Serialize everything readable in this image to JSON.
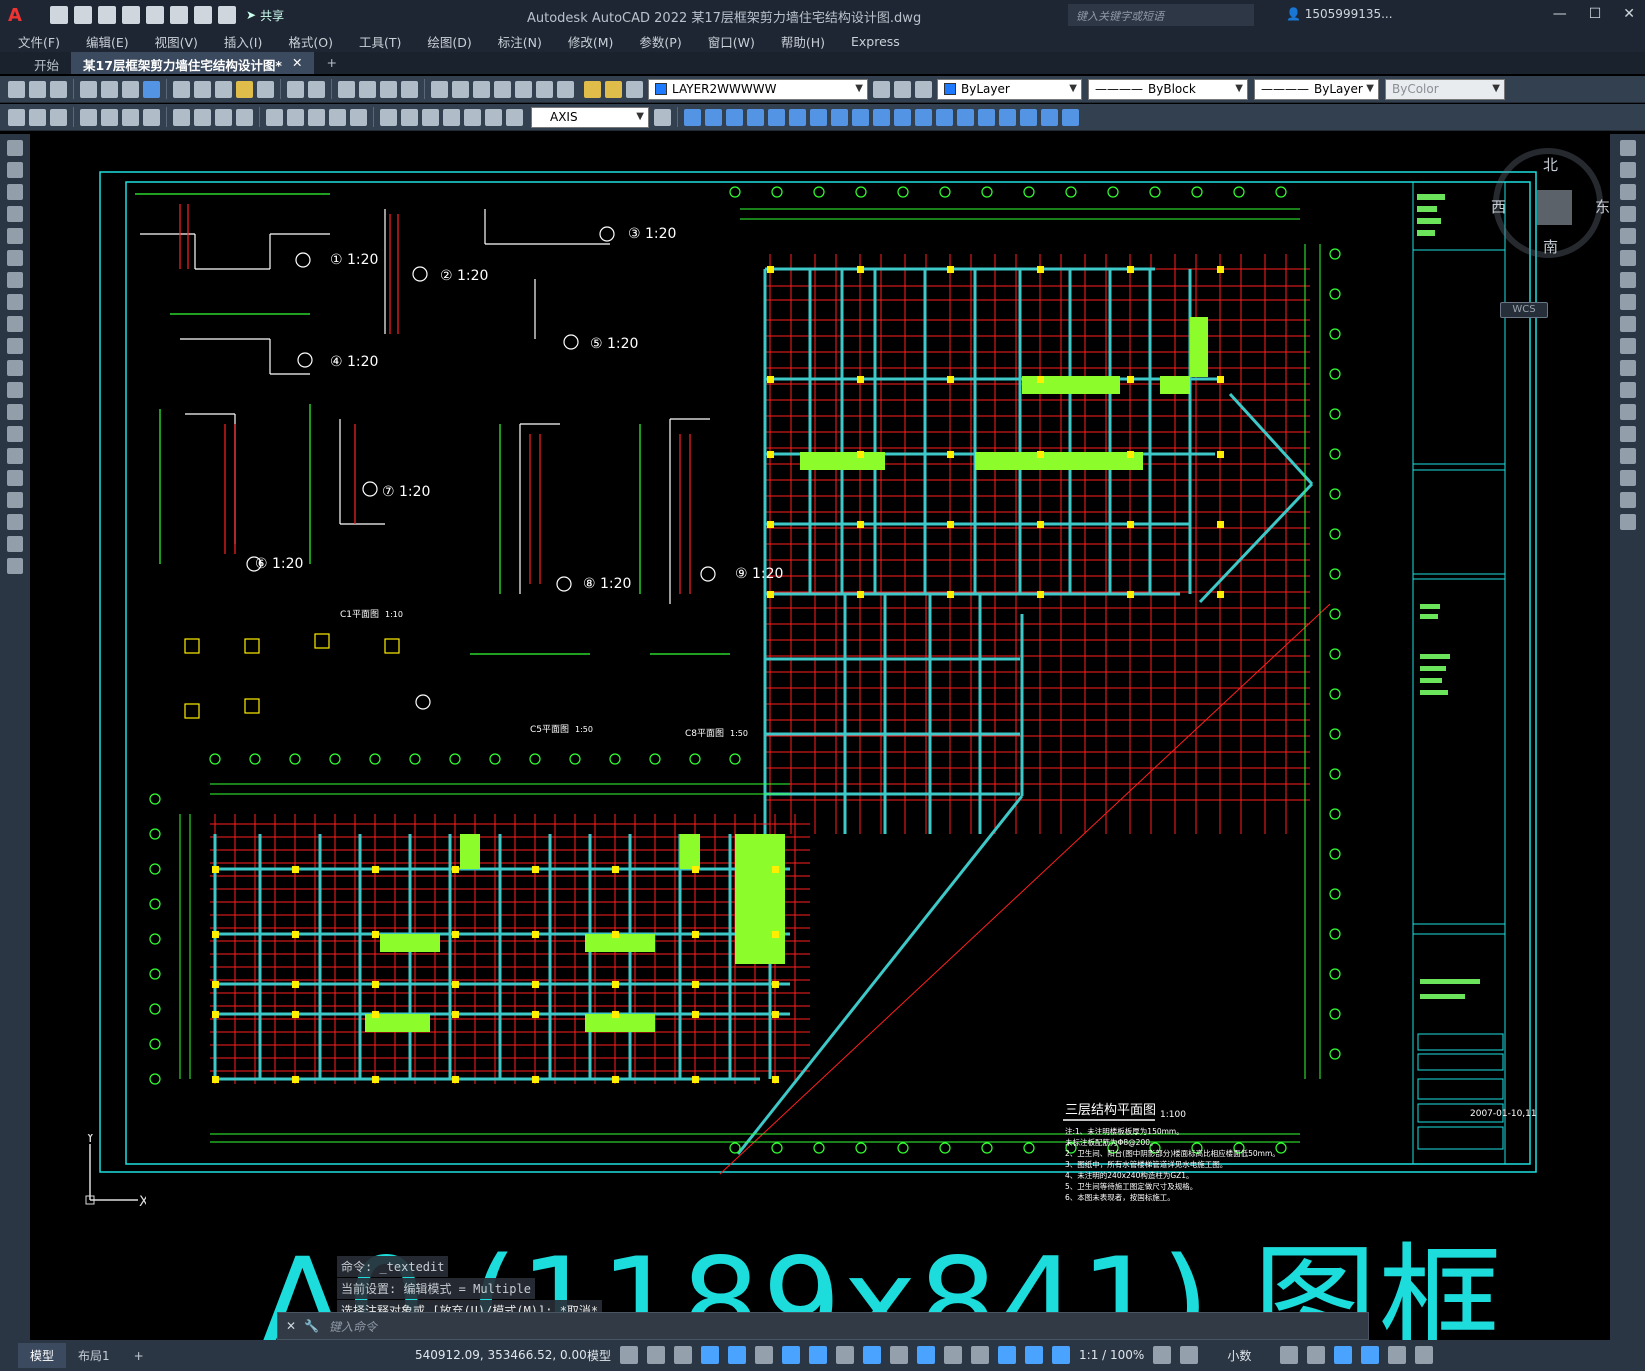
{
  "window": {
    "app_logo": "A",
    "title": "Autodesk AutoCAD 2022    某17层框架剪力墙住宅结构设计图.dwg",
    "share_label": "共享",
    "keyword_search_placeholder": "键入关键字或短语",
    "user": "1505999135...",
    "controls": [
      "—",
      "☐",
      "✕"
    ]
  },
  "menu": [
    "文件(F)",
    "编辑(E)",
    "视图(V)",
    "插入(I)",
    "格式(O)",
    "工具(T)",
    "绘图(D)",
    "标注(N)",
    "修改(M)",
    "参数(P)",
    "窗口(W)",
    "帮助(H)",
    "Express"
  ],
  "tabs": [
    {
      "label": "开始"
    },
    {
      "label": "某17层框架剪力墙住宅结构设计图*",
      "close": "✕"
    },
    {
      "label": "+"
    }
  ],
  "layer_toolbar": {
    "layer_name": "LAYER2WWWWW",
    "color": "ByLayer",
    "linetype": "ByBlock",
    "lineweight": "ByLayer",
    "plotstyle": "ByColor"
  },
  "dim_toolbar": {
    "dimstyle": "AXIS"
  },
  "viewcube": {
    "north": "北",
    "south": "南",
    "west": "西",
    "east": "东",
    "wcs": "WCS"
  },
  "ucs": {
    "y": "Y",
    "x": "X"
  },
  "drawing": {
    "detail_labels": [
      "① 1:20",
      "② 1:20",
      "③ 1:20",
      "④ 1:20",
      "⑤ 1:20",
      "⑥ 1:20",
      "⑦ 1:20",
      "⑧ 1:20",
      "⑨ 1:20"
    ],
    "plan_title": "三层结构平面图",
    "plan_scale": "1:100",
    "notes": [
      "注:1、未注明楼板板厚为150mm。",
      "    未标注板配筋为Φ8@200。",
      "2、卫生间、阳台(图中阴影部分)楼面标高比相应楼面低50mm。",
      "3、图纸中，所有水管楼梯管道详见水电施工图。",
      "4、未注明的240x240构造柱为GZ1。",
      "5、卫生间等待施工图定做尺寸及规格。",
      "6、本图未表现者，按国标施工。"
    ],
    "c1_plan": "C1平面图",
    "c1_scale": "1:10",
    "c5_plan": "C5平面图",
    "c5_scale": "1:50",
    "c8_plan": "C8平面图",
    "c8_scale": "1:50",
    "title_block_date": "2007-01-10,11"
  },
  "command": {
    "history": [
      "命令: _textedit",
      "当前设置: 编辑模式 = Multiple",
      "选择注释对象或 [放弃(U)/模式(M)]: *取消*"
    ],
    "placeholder": "键入命令"
  },
  "overlay_text": "A0 (1189x841) 图框",
  "status": {
    "tabs": [
      "模型",
      "布局1",
      "+"
    ],
    "coords": "540912.09, 353466.52, 0.00",
    "mode": "模型",
    "scale": "1:1 / 100%",
    "units": "小数"
  }
}
